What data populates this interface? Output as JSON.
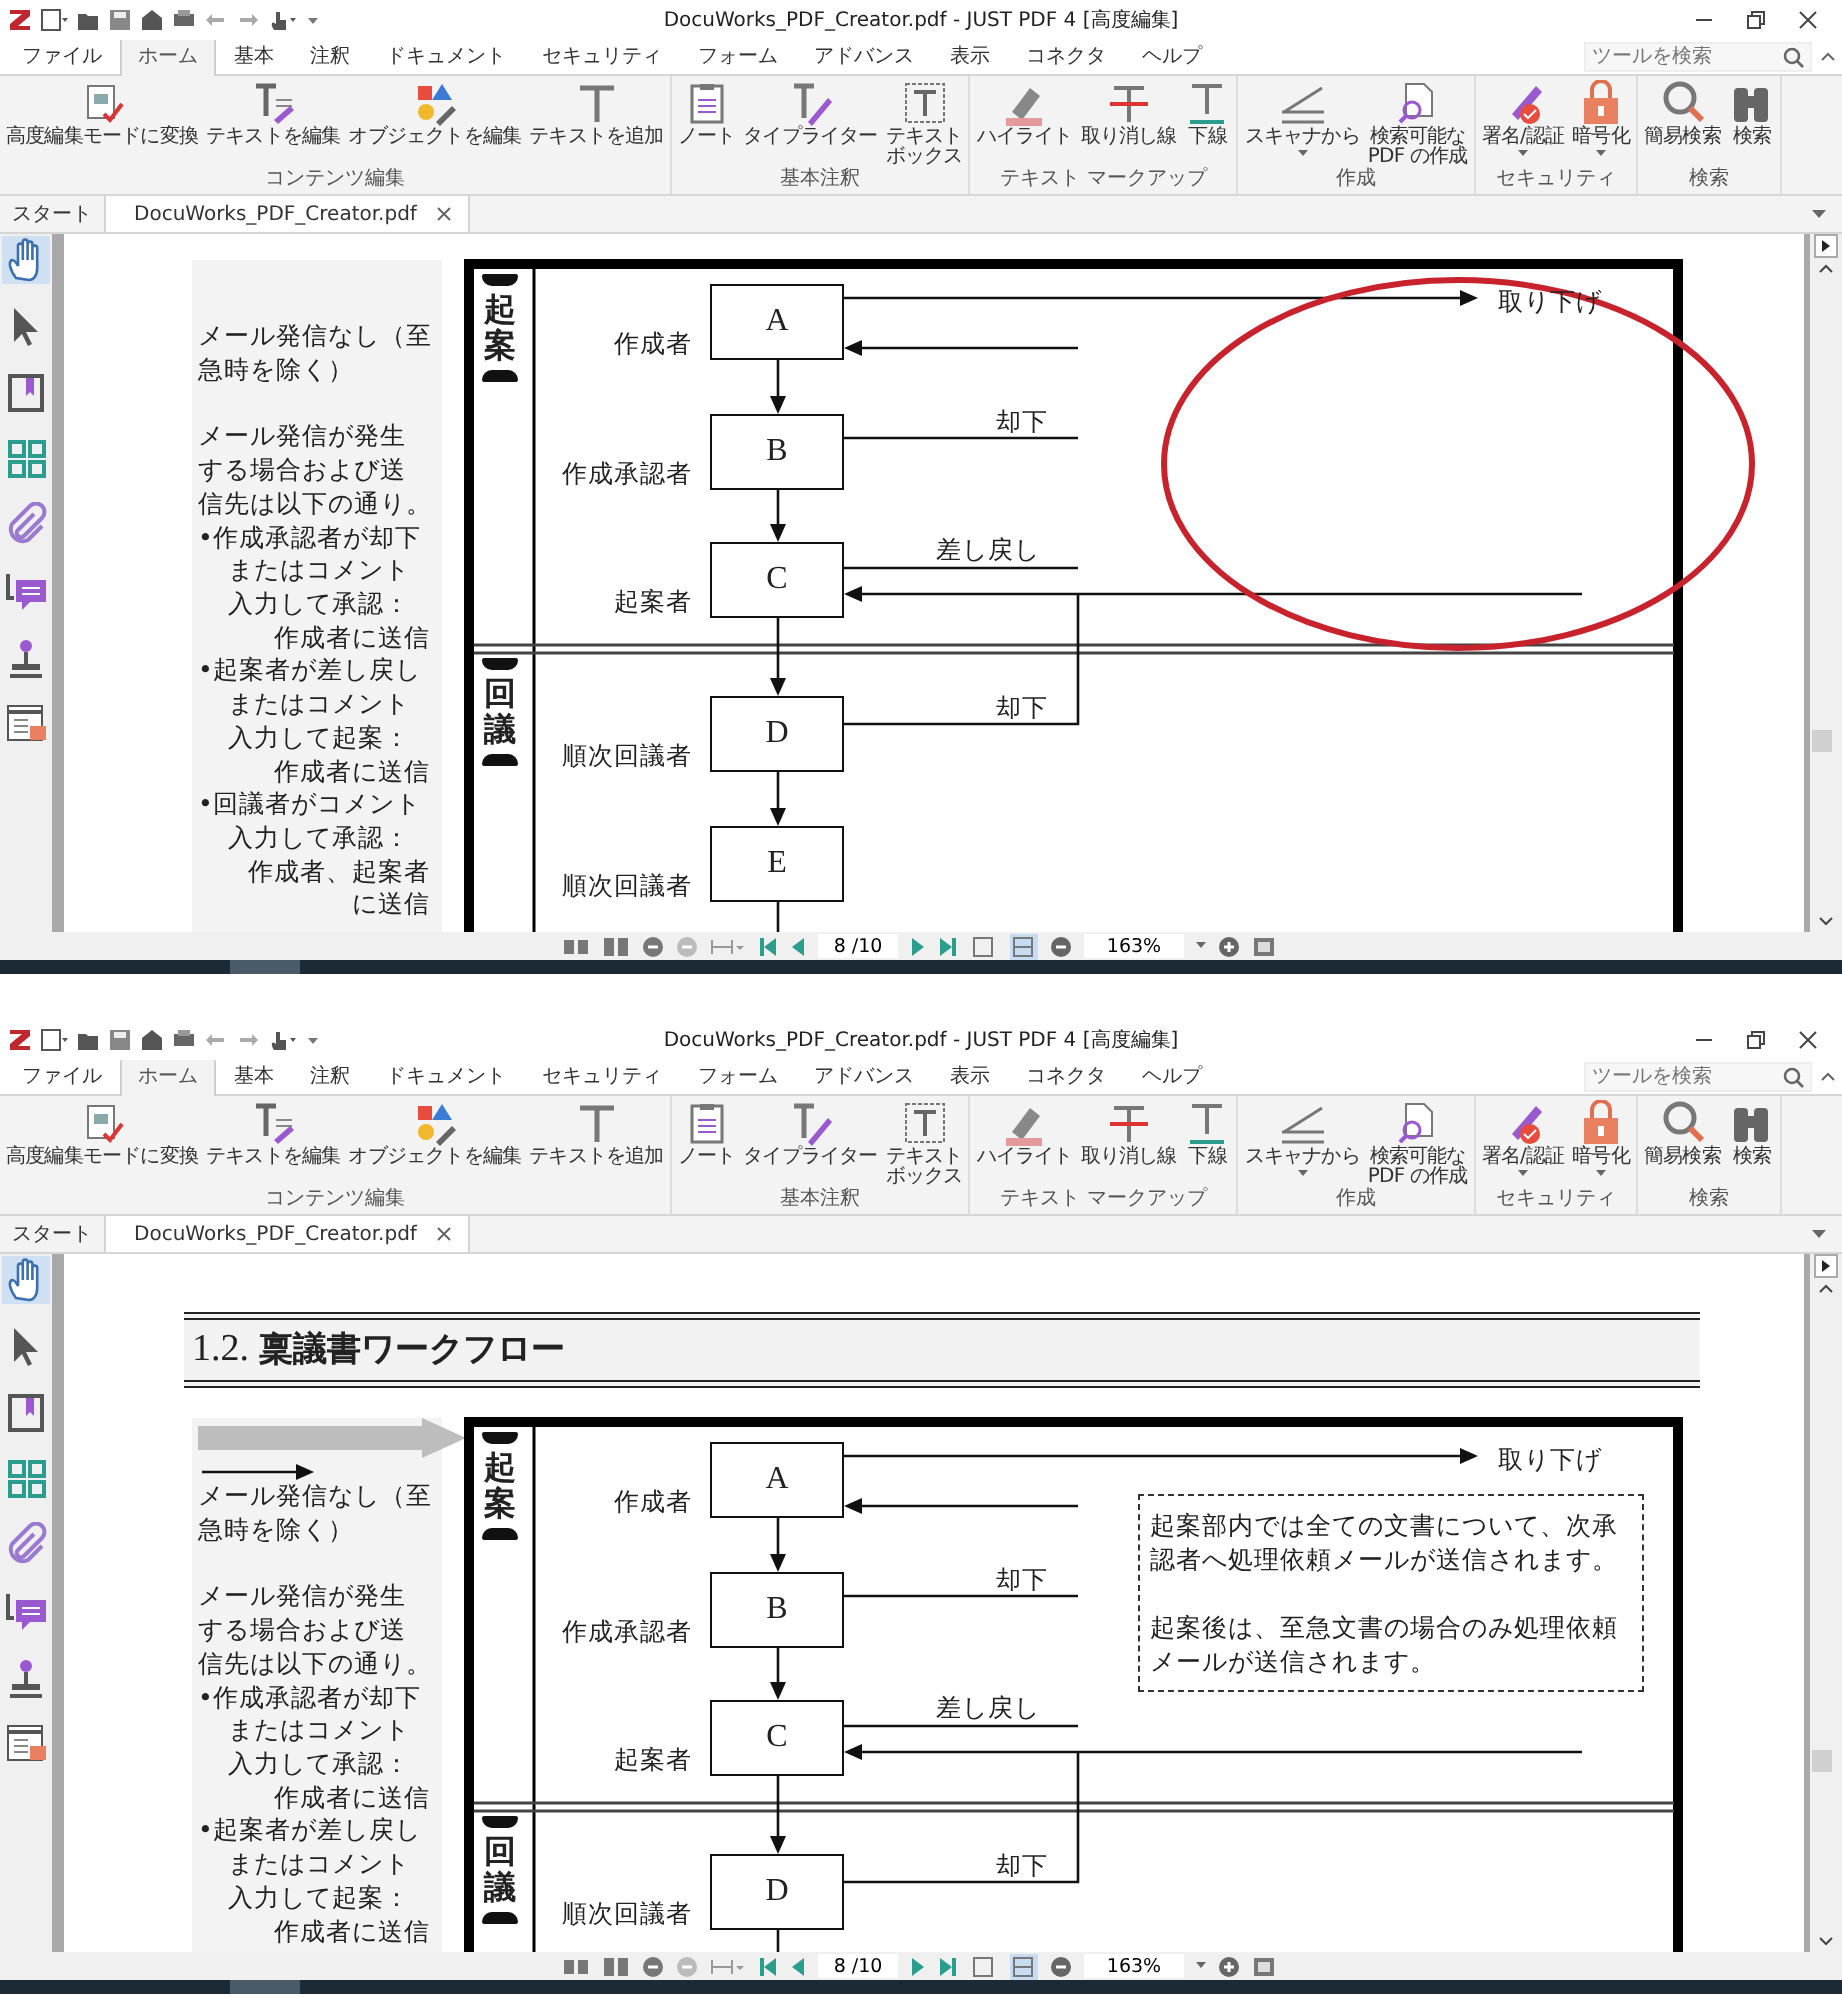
{
  "windows": [
    {
      "title": "DocuWorks_PDF_Creator.pdf - JUST PDF 4 [高度編集]",
      "menu_tabs": [
        {
          "label": "ファイル",
          "selected": false
        },
        {
          "label": "ホーム",
          "selected": true
        },
        {
          "label": "基本",
          "selected": false
        },
        {
          "label": "注釈",
          "selected": false
        },
        {
          "label": "ドキュメント",
          "selected": false
        },
        {
          "label": "セキュリティ",
          "selected": false
        },
        {
          "label": "フォーム",
          "selected": false
        },
        {
          "label": "アドバンス",
          "selected": false
        },
        {
          "label": "表示",
          "selected": false
        },
        {
          "label": "コネクタ",
          "selected": false
        },
        {
          "label": "ヘルプ",
          "selected": false
        }
      ],
      "tool_search": {
        "placeholder": "ツールを検索"
      },
      "ribbon_groups": [
        {
          "label": "コンテンツ編集",
          "buttons": [
            {
              "label": [
                "高度編集モードに変換"
              ],
              "has_menu": false
            },
            {
              "label": [
                "テキストを編集"
              ],
              "has_menu": false
            },
            {
              "label": [
                "オブジェクトを編集"
              ],
              "has_menu": false
            },
            {
              "label": [
                "テキストを追加"
              ],
              "has_menu": false
            }
          ]
        },
        {
          "label": "基本注釈",
          "buttons": [
            {
              "label": [
                "ノート"
              ],
              "has_menu": false
            },
            {
              "label": [
                "タイプライター"
              ],
              "has_menu": false
            },
            {
              "label": [
                "テキスト",
                "ボックス"
              ],
              "has_menu": false
            }
          ]
        },
        {
          "label": "テキスト マークアップ",
          "buttons": [
            {
              "label": [
                "ハイライト"
              ],
              "has_menu": false
            },
            {
              "label": [
                "取り消し線"
              ],
              "has_menu": false
            },
            {
              "label": [
                "下線"
              ],
              "has_menu": false
            }
          ]
        },
        {
          "label": "作成",
          "buttons": [
            {
              "label": [
                "スキャナから"
              ],
              "has_menu": true
            },
            {
              "label": [
                "検索可能な",
                "PDF の作成"
              ],
              "has_menu": false
            }
          ]
        },
        {
          "label": "セキュリティ",
          "buttons": [
            {
              "label": [
                "署名/認証"
              ],
              "has_menu": true
            },
            {
              "label": [
                "暗号化"
              ],
              "has_menu": true
            }
          ]
        },
        {
          "label": "検索",
          "buttons": [
            {
              "label": [
                "簡易検索"
              ],
              "has_menu": false
            },
            {
              "label": [
                "検索"
              ],
              "has_menu": false
            }
          ]
        }
      ],
      "doc_tabs": [
        {
          "label": "スタート",
          "selected": false,
          "closable": false
        },
        {
          "label": "DocuWorks_PDF_Creator.pdf",
          "selected": true,
          "closable": true
        }
      ],
      "tool_sidebar": [
        {
          "selected": true
        },
        {
          "selected": false
        },
        {
          "selected": false
        },
        {
          "selected": false
        },
        {
          "selected": false
        },
        {
          "selected": false
        },
        {
          "selected": false
        },
        {
          "selected": false
        }
      ],
      "page": {
        "left_notes": [
          {
            "kind": "para",
            "lines": [
              "メール発信なし（至",
              "急時を除く）"
            ]
          },
          {
            "kind": "para",
            "lines": [
              "メール発信が発生",
              "する場合および送",
              "信先は以下の通り。"
            ]
          },
          {
            "kind": "bullet",
            "lines": [
              "•作成承認者が却下",
              "またはコメント",
              "入力して承認："
            ],
            "recipient": [
              "作成者に送信"
            ]
          },
          {
            "kind": "bullet",
            "lines": [
              "•起案者が差し戻し",
              "またはコメント",
              "入力して起案："
            ],
            "recipient": [
              "作成者に送信"
            ]
          },
          {
            "kind": "bullet",
            "lines": [
              "•回議者がコメント",
              "入力して承認："
            ],
            "recipient": [
              "作成者、起案者",
              "に送信"
            ]
          }
        ],
        "lanes": [
          {
            "label": "起案"
          },
          {
            "label": "回議"
          }
        ],
        "nodes": [
          {
            "letter": "A",
            "role": "作成者"
          },
          {
            "letter": "B",
            "role": "作成承認者"
          },
          {
            "letter": "C",
            "role": "起案者"
          },
          {
            "letter": "D",
            "role": "順次回議者"
          },
          {
            "letter": "E",
            "role": "順次回議者"
          }
        ],
        "flows": [
          {
            "label": "取り下げ"
          },
          {
            "label": "却下"
          },
          {
            "label": "差し戻し"
          },
          {
            "label": "却下"
          }
        ],
        "annotation_ellipse": true
      },
      "status": {
        "page": "8 /10",
        "zoom": "163%",
        "layout_buttons": [
          {
            "selected": false
          },
          {
            "selected": true
          }
        ]
      }
    },
    {
      "title": "DocuWorks_PDF_Creator.pdf - JUST PDF 4 [高度編集]",
      "menu_tabs": [
        {
          "label": "ファイル",
          "selected": false
        },
        {
          "label": "ホーム",
          "selected": true
        },
        {
          "label": "基本",
          "selected": false
        },
        {
          "label": "注釈",
          "selected": false
        },
        {
          "label": "ドキュメント",
          "selected": false
        },
        {
          "label": "セキュリティ",
          "selected": false
        },
        {
          "label": "フォーム",
          "selected": false
        },
        {
          "label": "アドバンス",
          "selected": false
        },
        {
          "label": "表示",
          "selected": false
        },
        {
          "label": "コネクタ",
          "selected": false
        },
        {
          "label": "ヘルプ",
          "selected": false
        }
      ],
      "tool_search": {
        "placeholder": "ツールを検索"
      },
      "ribbon_groups": [
        {
          "label": "コンテンツ編集",
          "buttons": [
            {
              "label": [
                "高度編集モードに変換"
              ],
              "has_menu": false
            },
            {
              "label": [
                "テキストを編集"
              ],
              "has_menu": false
            },
            {
              "label": [
                "オブジェクトを編集"
              ],
              "has_menu": false
            },
            {
              "label": [
                "テキストを追加"
              ],
              "has_menu": false
            }
          ]
        },
        {
          "label": "基本注釈",
          "buttons": [
            {
              "label": [
                "ノート"
              ],
              "has_menu": false
            },
            {
              "label": [
                "タイプライター"
              ],
              "has_menu": false
            },
            {
              "label": [
                "テキスト",
                "ボックス"
              ],
              "has_menu": false
            }
          ]
        },
        {
          "label": "テキスト マークアップ",
          "buttons": [
            {
              "label": [
                "ハイライト"
              ],
              "has_menu": false
            },
            {
              "label": [
                "取り消し線"
              ],
              "has_menu": false
            },
            {
              "label": [
                "下線"
              ],
              "has_menu": false
            }
          ]
        },
        {
          "label": "作成",
          "buttons": [
            {
              "label": [
                "スキャナから"
              ],
              "has_menu": true
            },
            {
              "label": [
                "検索可能な",
                "PDF の作成"
              ],
              "has_menu": false
            }
          ]
        },
        {
          "label": "セキュリティ",
          "buttons": [
            {
              "label": [
                "署名/認証"
              ],
              "has_menu": true
            },
            {
              "label": [
                "暗号化"
              ],
              "has_menu": true
            }
          ]
        },
        {
          "label": "検索",
          "buttons": [
            {
              "label": [
                "簡易検索"
              ],
              "has_menu": false
            },
            {
              "label": [
                "検索"
              ],
              "has_menu": false
            }
          ]
        }
      ],
      "doc_tabs": [
        {
          "label": "スタート",
          "selected": false,
          "closable": false
        },
        {
          "label": "DocuWorks_PDF_Creator.pdf",
          "selected": true,
          "closable": true
        }
      ],
      "tool_sidebar": [
        {
          "selected": true
        },
        {
          "selected": false
        },
        {
          "selected": false
        },
        {
          "selected": false
        },
        {
          "selected": false
        },
        {
          "selected": false
        },
        {
          "selected": false
        },
        {
          "selected": false
        }
      ],
      "page": {
        "heading": "1.2. **稟議書ワークフロー**",
        "legend_arrows": true,
        "left_notes": [
          {
            "kind": "para",
            "lines": [
              "メール発信なし（至",
              "急時を除く）"
            ]
          },
          {
            "kind": "para",
            "lines": [
              "メール発信が発生",
              "する場合および送",
              "信先は以下の通り。"
            ]
          },
          {
            "kind": "bullet",
            "lines": [
              "•作成承認者が却下",
              "またはコメント",
              "入力して承認："
            ],
            "recipient": [
              "作成者に送信"
            ]
          },
          {
            "kind": "bullet",
            "lines": [
              "•起案者が差し戻し",
              "またはコメント",
              "入力して起案："
            ],
            "recipient": [
              "作成者に送信"
            ]
          }
        ],
        "lanes": [
          {
            "label": "起案"
          },
          {
            "label": "回議"
          }
        ],
        "nodes": [
          {
            "letter": "A",
            "role": "作成者"
          },
          {
            "letter": "B",
            "role": "作成承認者"
          },
          {
            "letter": "C",
            "role": "起案者"
          },
          {
            "letter": "D",
            "role": "順次回議者"
          }
        ],
        "flows": [
          {
            "label": "取り下げ"
          },
          {
            "label": "却下"
          },
          {
            "label": "差し戻し"
          },
          {
            "label": "却下"
          }
        ],
        "note_box": [
          "起案部内では全ての文書について、次承認者へ処理依頼メールが送信されます。",
          "起案後は、至急文書の場合のみ処理依頼メールが送信されます。"
        ]
      },
      "status": {
        "page": "8 /10",
        "zoom": "163%",
        "layout_buttons": [
          {
            "selected": false
          },
          {
            "selected": true
          }
        ]
      }
    }
  ]
}
